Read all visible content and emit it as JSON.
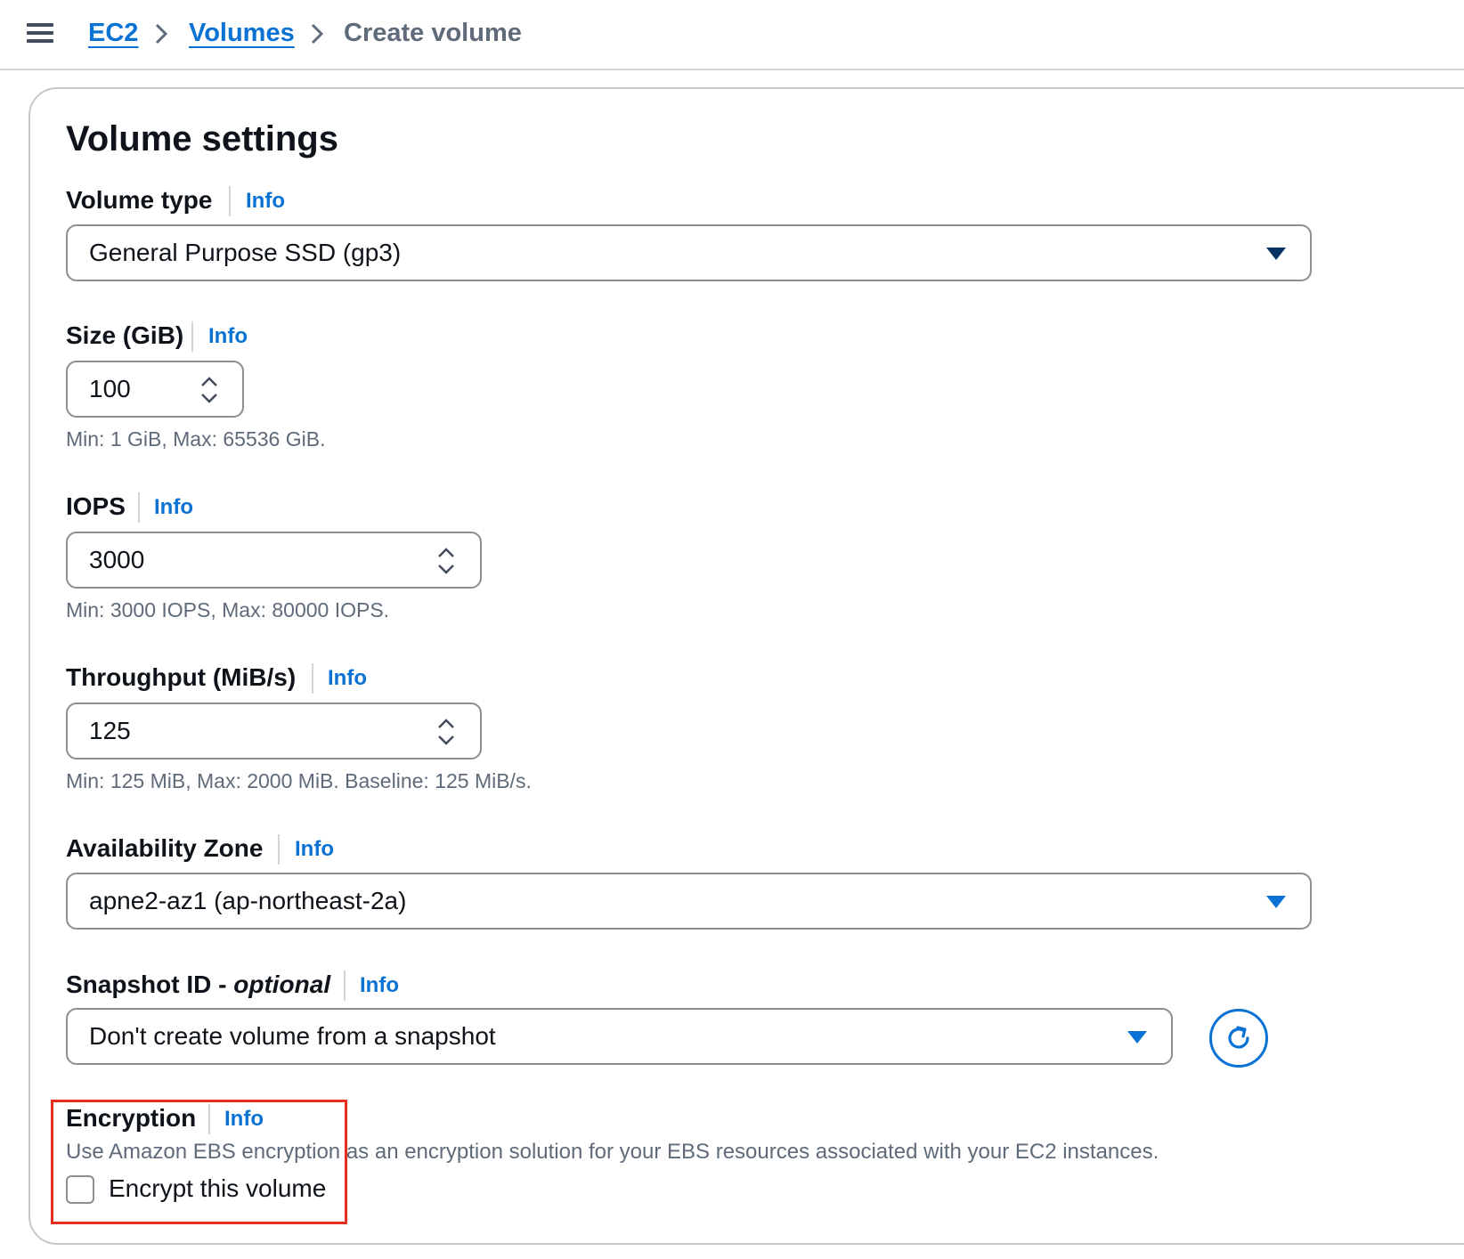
{
  "breadcrumb": {
    "items": [
      {
        "label": "EC2"
      },
      {
        "label": "Volumes"
      },
      {
        "label": "Create volume"
      }
    ]
  },
  "panel": {
    "title": "Volume settings"
  },
  "volume_type": {
    "label": "Volume type",
    "info": "Info",
    "selected": "General Purpose SSD (gp3)"
  },
  "size": {
    "label": "Size (GiB)",
    "info": "Info",
    "value": "100",
    "hint": "Min: 1 GiB, Max: 65536 GiB."
  },
  "iops": {
    "label": "IOPS",
    "info": "Info",
    "value": "3000",
    "hint": "Min: 3000 IOPS, Max: 80000 IOPS."
  },
  "throughput": {
    "label": "Throughput (MiB/s)",
    "info": "Info",
    "value": "125",
    "hint": "Min: 125 MiB, Max: 2000 MiB. Baseline: 125 MiB/s."
  },
  "availability_zone": {
    "label": "Availability Zone",
    "info": "Info",
    "selected": "apne2-az1 (ap-northeast-2a)"
  },
  "snapshot": {
    "label": "Snapshot ID - ",
    "label_optional": "optional",
    "info": "Info",
    "selected": "Don't create volume from a snapshot"
  },
  "encryption": {
    "label": "Encryption",
    "info": "Info",
    "description": "Use Amazon EBS encryption as an encryption solution for your EBS resources associated with your EC2 instances.",
    "checkbox_label": "Encrypt this volume",
    "checked": false
  },
  "colors": {
    "link": "#0972d3",
    "text": "#0f141a",
    "secondary_text": "#5f6b7a",
    "border": "#8c8c94",
    "highlight": "#e62e1e",
    "caret_dark": "#033160"
  }
}
